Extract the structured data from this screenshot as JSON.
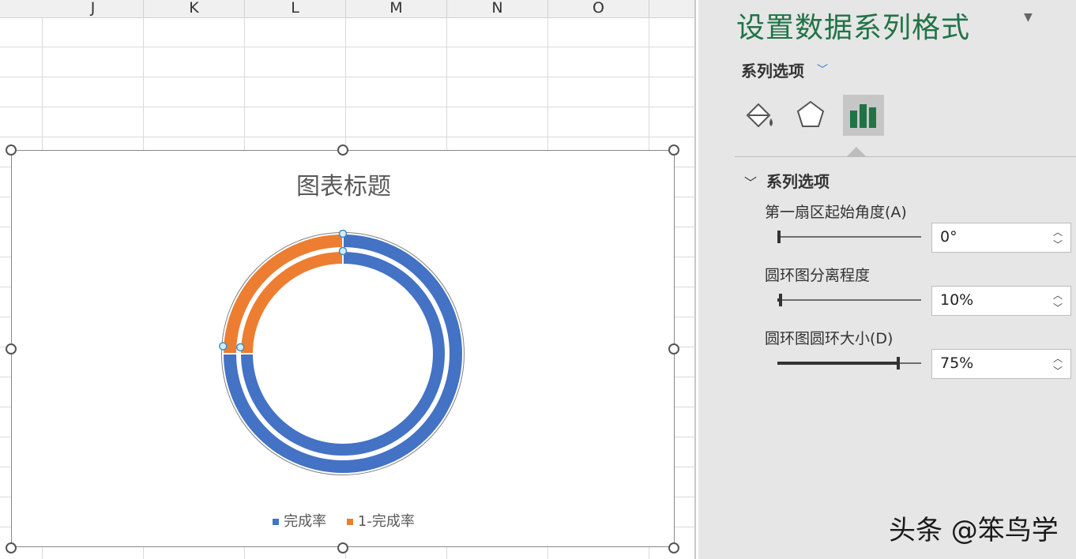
{
  "spreadsheet": {
    "columns": [
      "J",
      "K",
      "L",
      "M",
      "N",
      "O"
    ]
  },
  "chart": {
    "title": "图表标题",
    "legend": [
      {
        "label": "完成率",
        "color": "#4472c4"
      },
      {
        "label": "1-完成率",
        "color": "#ed7d31"
      }
    ]
  },
  "chart_data": {
    "type": "doughnut",
    "title": "图表标题",
    "series": [
      {
        "name": "outer-ring",
        "slices": [
          {
            "label": "完成率",
            "value": 0.75
          },
          {
            "label": "1-完成率",
            "value": 0.25
          }
        ]
      },
      {
        "name": "inner-ring",
        "slices": [
          {
            "label": "完成率",
            "value": 0.75
          },
          {
            "label": "1-完成率",
            "value": 0.25
          }
        ]
      }
    ],
    "categories": [
      "完成率",
      "1-完成率"
    ],
    "colors": [
      "#4472c4",
      "#ed7d31"
    ],
    "legend_position": "bottom"
  },
  "pane": {
    "title": "设置数据系列格式",
    "dropdown_label": "系列选项",
    "section_label": "系列选项",
    "options": [
      {
        "label": "第一扇区起始角度(A)",
        "value": "0°",
        "slider_fraction": 0.0
      },
      {
        "label": "圆环图分离程度",
        "value": "10%",
        "slider_fraction": 0.02
      },
      {
        "label": "圆环图圆环大小(D)",
        "value": "75%",
        "slider_fraction": 0.84
      }
    ],
    "accent_color": "#217346"
  },
  "watermark": "头条 @笨鸟学"
}
